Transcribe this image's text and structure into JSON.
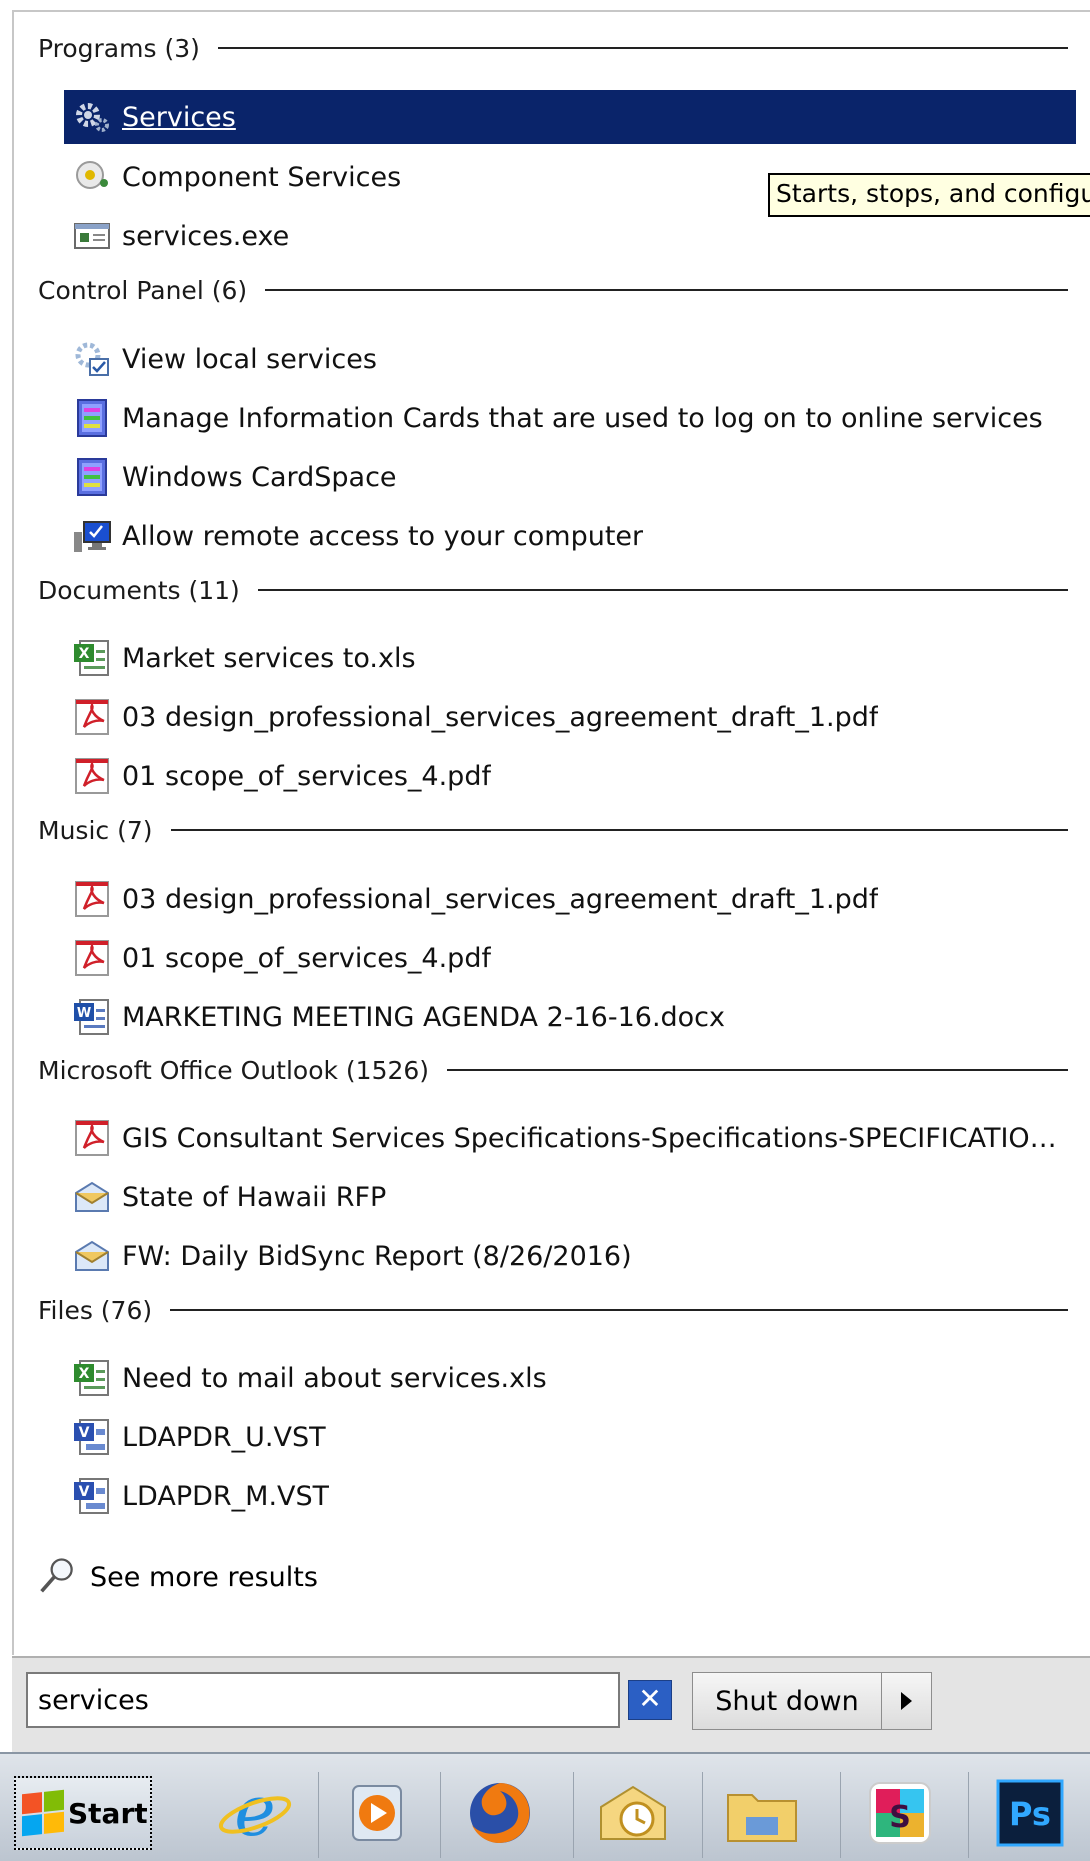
{
  "tooltip": "Starts, stops, and configures Windows services.",
  "groups": [
    {
      "category": "Programs (3)",
      "items": [
        {
          "label": "Services",
          "icon": "gear-icon",
          "selected": true
        },
        {
          "label": "Component Services",
          "icon": "component-services-icon"
        },
        {
          "label": "services.exe",
          "icon": "exe-window-icon"
        }
      ]
    },
    {
      "category": "Control Panel (6)",
      "items": [
        {
          "label": "View local services",
          "icon": "services-settings-icon"
        },
        {
          "label": "Manage Information Cards that are used to log on to online services",
          "icon": "cardspace-icon"
        },
        {
          "label": "Windows CardSpace",
          "icon": "cardspace-icon"
        },
        {
          "label": "Allow remote access to your computer",
          "icon": "remote-monitor-icon"
        }
      ]
    },
    {
      "category": "Documents (11)",
      "items": [
        {
          "label": "Market services to.xls",
          "icon": "excel-file-icon"
        },
        {
          "label": "03 design_professional_services_agreement_draft_1.pdf",
          "icon": "pdf-file-icon"
        },
        {
          "label": "01 scope_of_services_4.pdf",
          "icon": "pdf-file-icon"
        }
      ]
    },
    {
      "category": "Music (7)",
      "items": [
        {
          "label": "03 design_professional_services_agreement_draft_1.pdf",
          "icon": "pdf-file-icon"
        },
        {
          "label": "01 scope_of_services_4.pdf",
          "icon": "pdf-file-icon"
        },
        {
          "label": "MARKETING MEETING AGENDA 2-16-16.docx",
          "icon": "word-file-icon"
        }
      ]
    },
    {
      "category": "Microsoft Office Outlook (1526)",
      "items": [
        {
          "label": "GIS Consultant Services Specifications-Specifications-SPECIFICATIONS...",
          "icon": "pdf-file-icon"
        },
        {
          "label": "State of Hawaii RFP",
          "icon": "email-envelope-icon"
        },
        {
          "label": "FW: Daily BidSync Report (8/26/2016)",
          "icon": "email-envelope-icon"
        }
      ]
    },
    {
      "category": "Files (76)",
      "items": [
        {
          "label": "Need to mail about services.xls",
          "icon": "excel-file-icon"
        },
        {
          "label": "LDAPDR_U.VST",
          "icon": "visio-file-icon"
        },
        {
          "label": "LDAPDR_M.VST",
          "icon": "visio-file-icon"
        }
      ]
    }
  ],
  "see_more": "See more results",
  "search": {
    "value": "services"
  },
  "shutdown_label": "Shut down",
  "start_label": "Start",
  "taskbar_apps": [
    "internet-explorer-icon",
    "media-player-icon",
    "firefox-icon",
    "outlook-icon",
    "file-explorer-icon",
    "slack-icon",
    "photoshop-icon"
  ],
  "colors": {
    "selection": "#0a246a",
    "tooltip_bg": "#ffffe1"
  }
}
